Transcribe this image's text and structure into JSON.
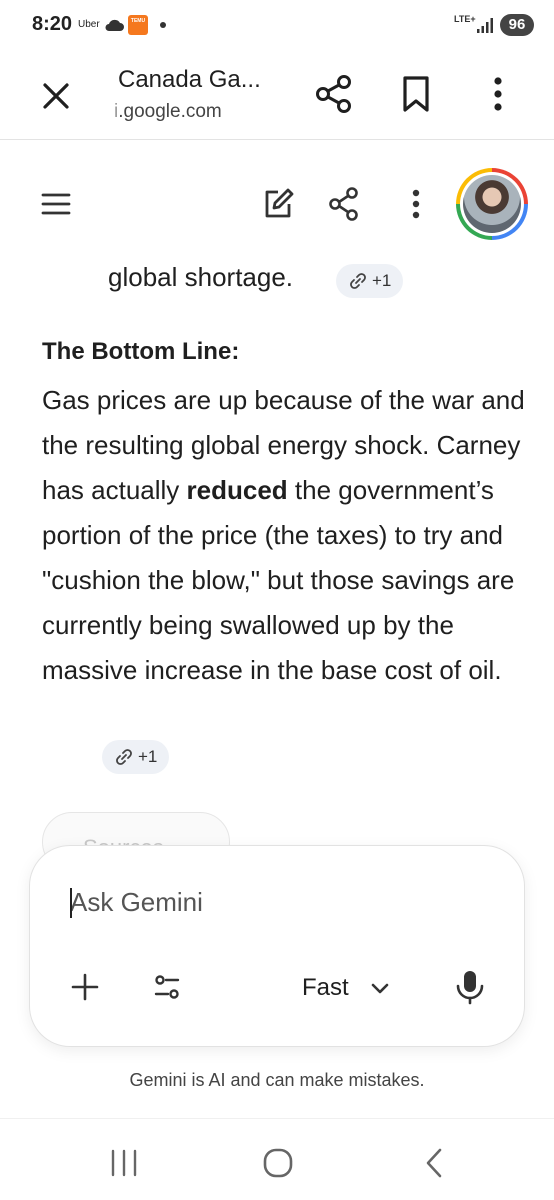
{
  "status_bar": {
    "time": "8:20",
    "uber_label": "Uber",
    "temu_label": "TEMU",
    "network": "LTE+",
    "battery": "96",
    "icons": [
      "cloud-icon",
      "temu-app-icon",
      "notification-dot-icon",
      "signal-icon"
    ]
  },
  "browser": {
    "title": "Canada Ga...",
    "url_prefix": "i",
    "url": ".google.com",
    "icons": [
      "close-icon",
      "share-icon",
      "bookmark-icon",
      "more-vert-icon"
    ]
  },
  "gemini_header": {
    "icons": [
      "menu-icon",
      "edit-icon",
      "share-icon",
      "more-vert-icon",
      "avatar"
    ]
  },
  "response": {
    "line_top": "global shortage.",
    "chip_1": "+1",
    "heading": "The Bottom Line:",
    "para_part1": "Gas prices are up because of the war and the resulting global energy shock. Carney has actually ",
    "para_bold": "reduced",
    "para_part2": " the government’s portion of the price (the taxes) to try and \"cushion the blow,\" but those savings are currently being swallowed up by the massive increase in the base cost of oil.",
    "chip_2": "+1",
    "sources_label": "Sources"
  },
  "input_card": {
    "placeholder": "Ask Gemini",
    "mode_label": "Fast",
    "icons": [
      "plus-icon",
      "tools-icon",
      "chevron-down-icon",
      "mic-icon"
    ]
  },
  "disclaimer": "Gemini is AI and can make mistakes.",
  "nav_bar": {
    "icons": [
      "recent-apps-icon",
      "home-icon",
      "back-icon"
    ]
  },
  "colors": {
    "chip_bg": "#eef1f6",
    "text": "#1f1f1f",
    "avatar_ring": [
      "#ea4335",
      "#4285f4",
      "#34a853",
      "#fbbc05"
    ]
  }
}
